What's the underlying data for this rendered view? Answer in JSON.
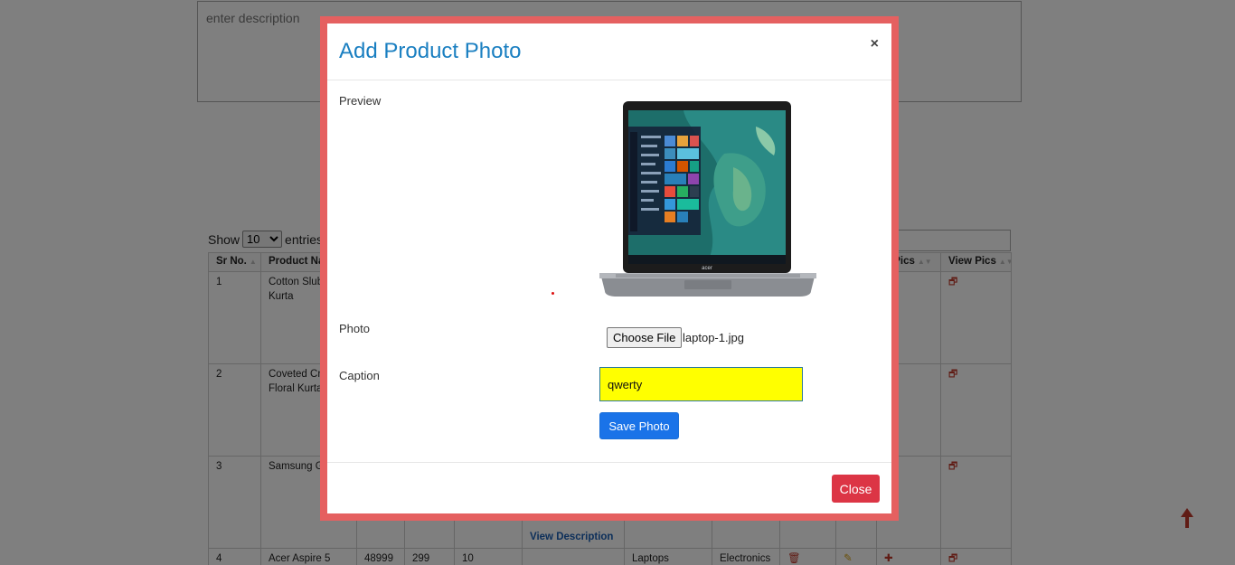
{
  "background": {
    "description_placeholder": "enter description",
    "show_label": "Show",
    "entries_value": "10",
    "entries_label": "entries",
    "table": {
      "headers": [
        "Sr No.",
        "Product Na",
        "",
        "",
        "",
        "",
        "",
        "",
        "",
        "",
        "d Pics",
        "View Pics"
      ],
      "rows": [
        {
          "sr": "1",
          "name": "Cotton Slub Long Kurta",
          "price": "",
          "qty": "",
          "stock": "",
          "category": "",
          "type": ""
        },
        {
          "sr": "2",
          "name": "Coveted Cre Floral Kurta",
          "price": "",
          "qty": "",
          "stock": "",
          "category": "",
          "type": ""
        },
        {
          "sr": "3",
          "name": "Samsung G Slip",
          "price": "",
          "qty": "",
          "stock": "",
          "category": "",
          "type": ""
        },
        {
          "sr": "4",
          "name": "Acer Aspire 5",
          "price": "48999",
          "qty": "299",
          "stock": "10",
          "category": "Laptops",
          "type": "Electronics"
        }
      ]
    },
    "view_description_link": "View Description"
  },
  "modal": {
    "title": "Add Product Photo",
    "close_x": "×",
    "preview_label": "Preview",
    "photo_label": "Photo",
    "choose_file_label": "Choose File",
    "file_name": "laptop-1.jpg",
    "caption_label": "Caption",
    "caption_value": "qwerty",
    "save_button": "Save Photo",
    "close_button": "Close"
  },
  "colors": {
    "modal_border": "#e56060",
    "title": "#1a7fc1",
    "caption_bg": "#ffff00",
    "save_button": "#1a73e8",
    "close_button": "#dc3545"
  }
}
